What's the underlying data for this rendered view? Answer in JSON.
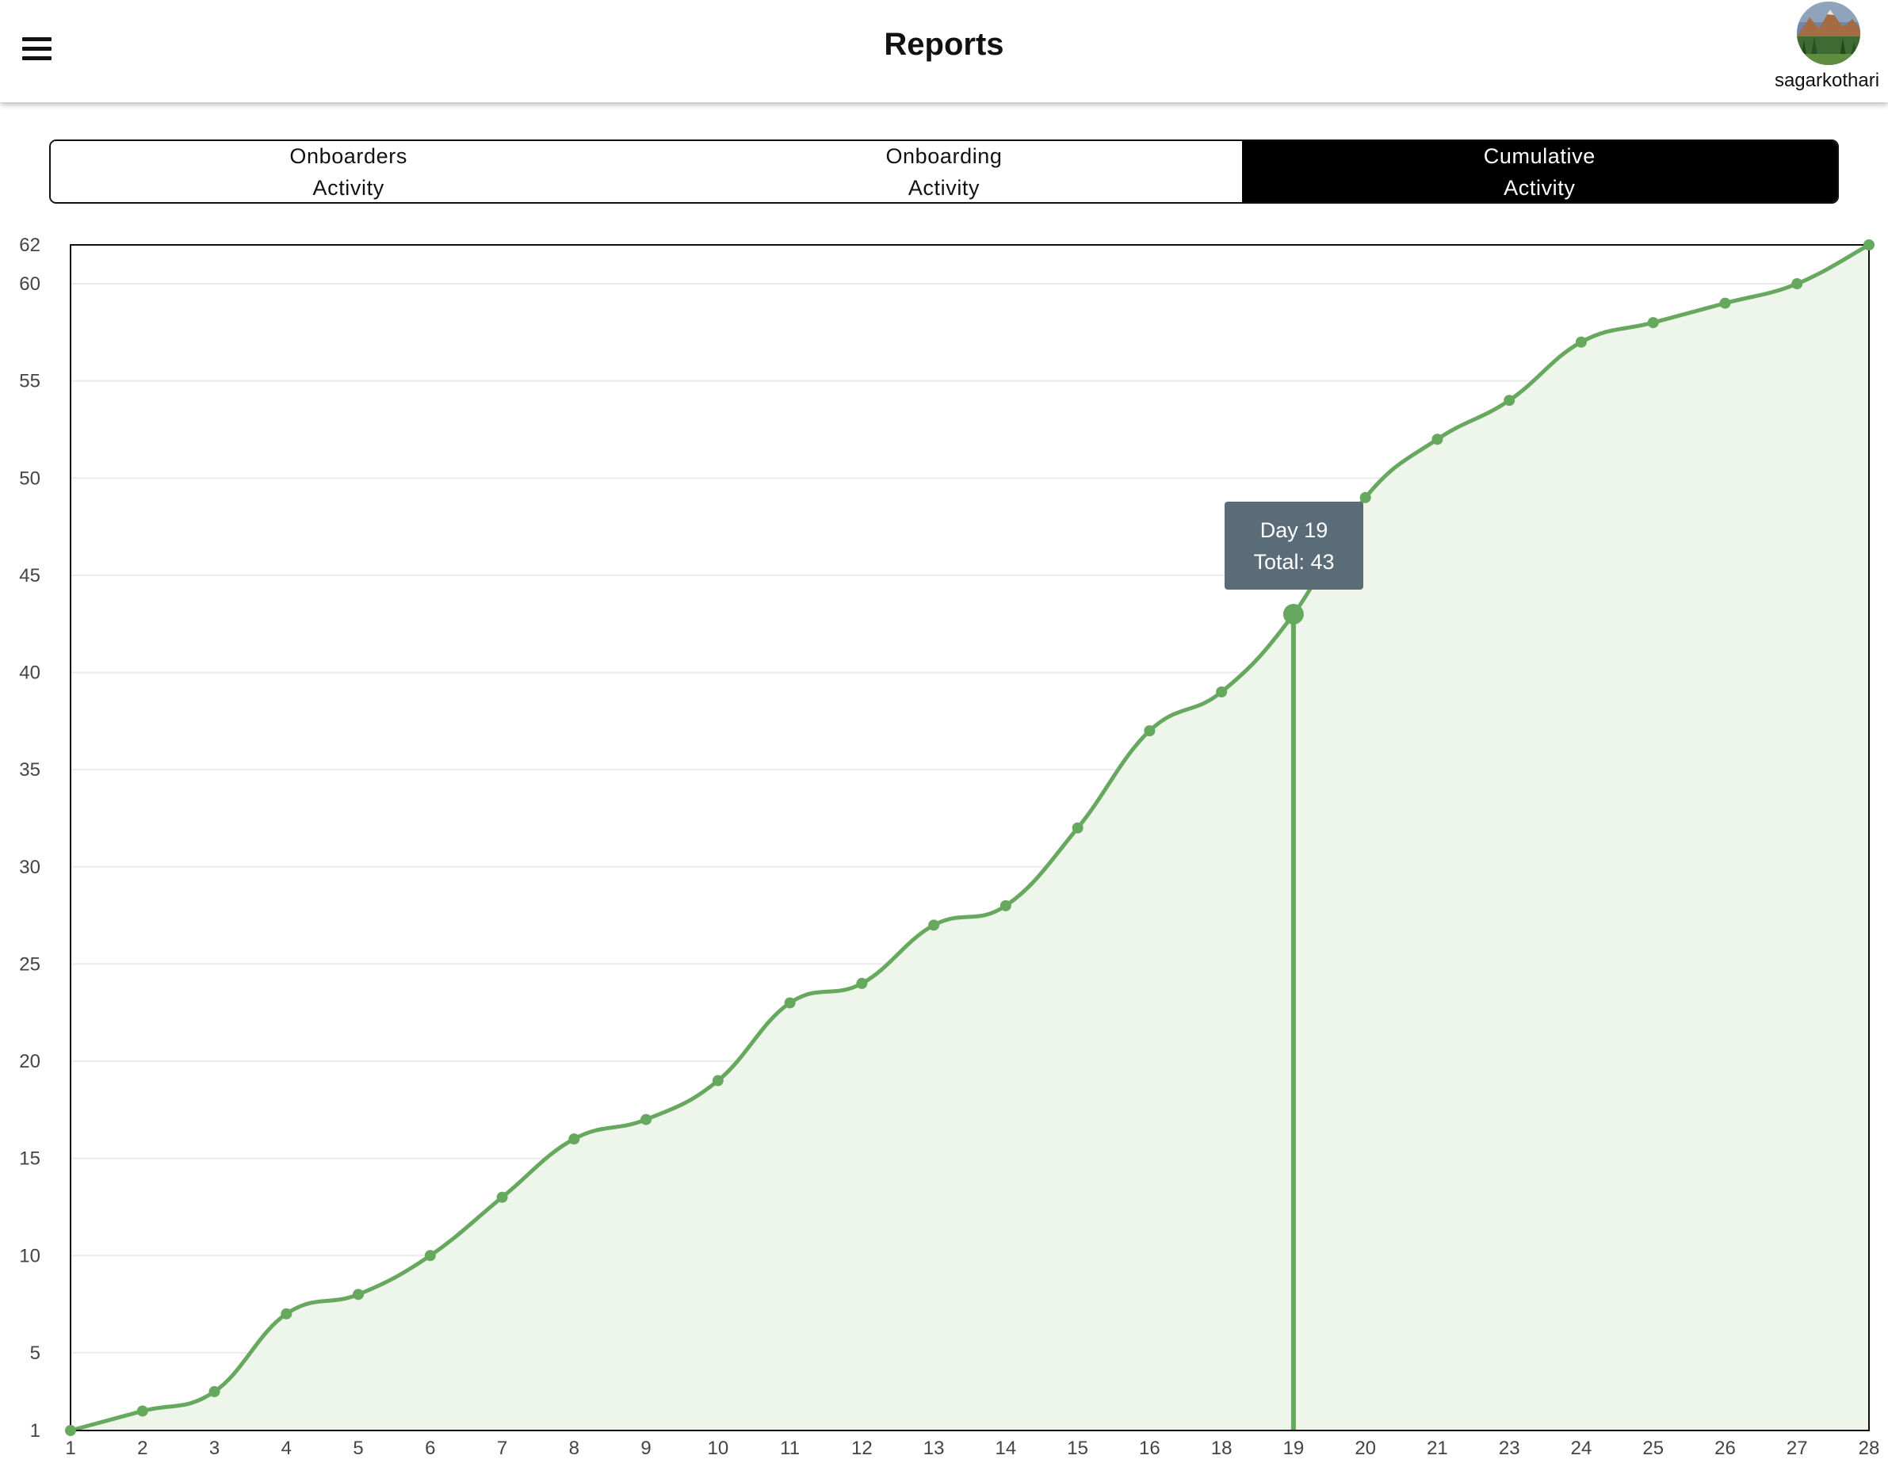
{
  "header": {
    "title": "Reports",
    "menu_icon": "hamburger-menu-icon",
    "username": "sagarkothari",
    "avatar": "mountain-landscape-avatar"
  },
  "tabs": [
    {
      "label": "Onboarders\nActivity",
      "active": false
    },
    {
      "label": "Onboarding\nActivity",
      "active": false
    },
    {
      "label": "Cumulative\nActivity",
      "active": true
    }
  ],
  "tooltip": {
    "line1": "Day 19",
    "line2": "Total: 43"
  },
  "colors": {
    "line": "#67a85f",
    "fill": "#eef6eb",
    "tooltip_bg": "#5a6c77",
    "active_tab": "#000000"
  },
  "chart_data": {
    "type": "area",
    "x": [
      "1",
      "2",
      "3",
      "4",
      "5",
      "6",
      "7",
      "8",
      "9",
      "10",
      "11",
      "12",
      "13",
      "14",
      "15",
      "16",
      "18",
      "19",
      "20",
      "21",
      "23",
      "24",
      "25",
      "26",
      "27",
      "28"
    ],
    "values": [
      1,
      2,
      3,
      7,
      8,
      10,
      13,
      16,
      17,
      19,
      23,
      24,
      27,
      28,
      32,
      37,
      39,
      43,
      49,
      52,
      54,
      57,
      58,
      59,
      60,
      62
    ],
    "yticks": [
      1,
      5,
      10,
      15,
      20,
      25,
      30,
      35,
      40,
      45,
      50,
      55,
      60,
      62
    ],
    "ylim": [
      1,
      62
    ],
    "grid": true,
    "highlight_index": 17,
    "title": "",
    "xlabel": "",
    "ylabel": ""
  }
}
